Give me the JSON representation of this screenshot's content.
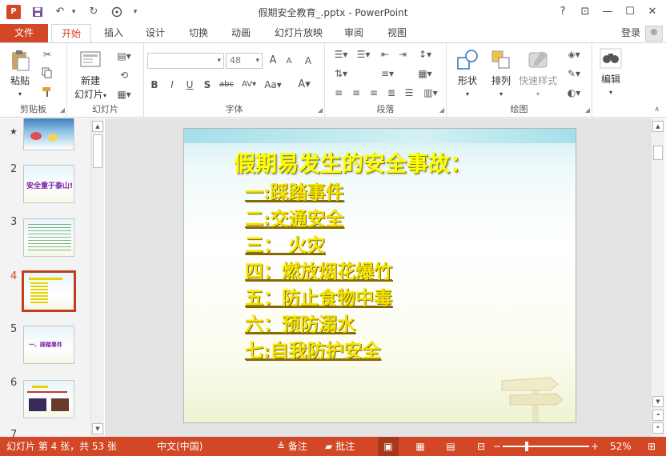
{
  "window": {
    "title": "假期安全教育_.pptx - PowerPoint",
    "app_badge": "P",
    "qat": {
      "undo": "↶",
      "redo": "↻",
      "more": "▾"
    },
    "buttons": {
      "help": "?",
      "restore_ribbon": "⊡",
      "minimize": "—",
      "maximize": "☐",
      "close": "✕"
    }
  },
  "tabs": {
    "file": "文件",
    "items": [
      "开始",
      "插入",
      "设计",
      "切换",
      "动画",
      "幻灯片放映",
      "审阅",
      "视图"
    ],
    "active": "开始",
    "login": "登录"
  },
  "ribbon": {
    "clipboard": {
      "label": "剪贴板",
      "paste": "粘贴"
    },
    "slides": {
      "label": "幻灯片",
      "new_slide_line1": "新建",
      "new_slide_line2": "幻灯片"
    },
    "font": {
      "label": "字体",
      "font_name": "",
      "font_size": "48",
      "bold": "B",
      "italic": "I",
      "underline": "U",
      "shadow": "S",
      "strike": "abc",
      "char_spacing": "AV",
      "case": "Aa",
      "font_color": "A",
      "grow": "A",
      "shrink": "A",
      "clear": "A"
    },
    "paragraph": {
      "label": "段落"
    },
    "drawing": {
      "label": "绘图",
      "shapes": "形状",
      "arrange": "排列",
      "quick_styles": "快速样式"
    },
    "editing": {
      "label": "编辑",
      "edit": "编辑"
    }
  },
  "thumbnails": {
    "items": [
      {
        "num": "",
        "text": ""
      },
      {
        "num": "2",
        "text": "安全重于泰山!"
      },
      {
        "num": "3",
        "text": ""
      },
      {
        "num": "4",
        "text": ""
      },
      {
        "num": "5",
        "text": "一、踩踏事件"
      },
      {
        "num": "6",
        "text": ""
      },
      {
        "num": "7",
        "text": ""
      }
    ],
    "active_num": "4",
    "star": "★"
  },
  "slide": {
    "title": "假期易发生的安全事故：",
    "items": [
      "一:踩踏事件",
      "二:交通安全",
      "三： 火灾",
      "四：燃放烟花爆竹",
      "五：防止食物中毒",
      "六：预防溺水",
      "七:自我防护安全"
    ]
  },
  "status": {
    "slide_info": "幻灯片 第 4 张，共 53 张",
    "language": "中文(中国)",
    "notes": "备注",
    "comments": "批注",
    "zoom_minus": "−",
    "zoom_plus": "+",
    "zoom": "52%",
    "zoom_level": 0.52
  },
  "colors": {
    "accent": "#D24726",
    "slide_text": "#FFFF00"
  }
}
